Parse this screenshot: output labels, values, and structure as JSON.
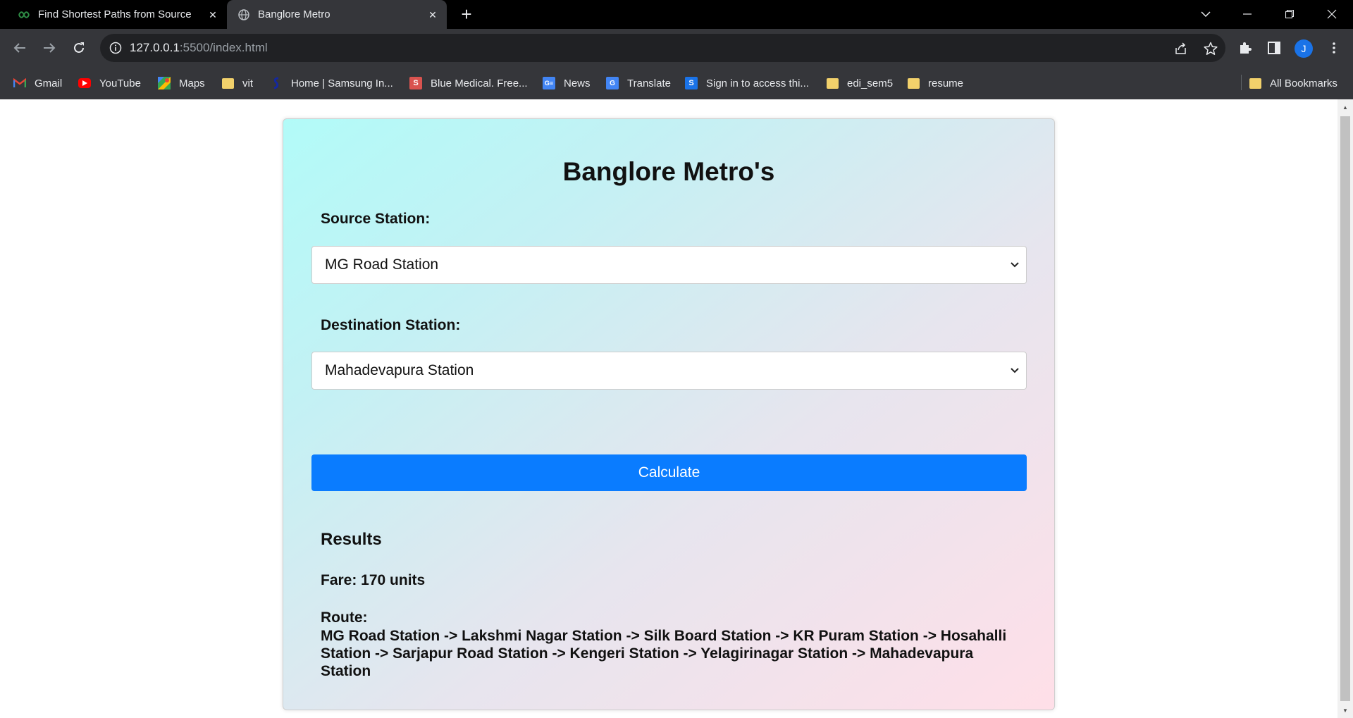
{
  "browser": {
    "tabs": [
      {
        "title": "Find Shortest Paths from Source",
        "icon": "gfg-icon"
      },
      {
        "title": "Banglore Metro",
        "icon": "globe-icon"
      }
    ],
    "url_host": "127.0.0.1",
    "url_rest": ":5500/index.html",
    "avatar_letter": "J",
    "bookmarks": [
      {
        "label": "Gmail",
        "icon": "gmail-icon"
      },
      {
        "label": "YouTube",
        "icon": "youtube-icon"
      },
      {
        "label": "Maps",
        "icon": "maps-icon"
      },
      {
        "label": "vit",
        "icon": "folder-icon"
      },
      {
        "label": "Home | Samsung In...",
        "icon": "samsung-icon"
      },
      {
        "label": "Blue Medical. Free...",
        "icon": "s-red-icon"
      },
      {
        "label": "News",
        "icon": "news-icon"
      },
      {
        "label": "Translate",
        "icon": "translate-icon"
      },
      {
        "label": "Sign in to access thi...",
        "icon": "s-blue-icon"
      },
      {
        "label": "edi_sem5",
        "icon": "folder-icon"
      },
      {
        "label": "resume",
        "icon": "folder-icon"
      }
    ],
    "all_bookmarks": "All Bookmarks"
  },
  "page": {
    "title": "Banglore Metro's",
    "source_label": "Source Station:",
    "source_value": "MG Road Station",
    "destination_label": "Destination Station:",
    "destination_value": "Mahadevapura Station",
    "calculate_label": "Calculate",
    "results_heading": "Results",
    "fare_text": "Fare: 170 units",
    "route_label": "Route:",
    "route_text": "MG Road Station -> Lakshmi Nagar Station -> Silk Board Station -> KR Puram Station -> Hosahalli Station -> Sarjapur Road Station -> Kengeri Station -> Yelagirinagar Station -> Mahadevapura Station"
  },
  "colors": {
    "button": "#0a7cff",
    "tabbar": "#000000",
    "toolbar": "#35363a"
  }
}
